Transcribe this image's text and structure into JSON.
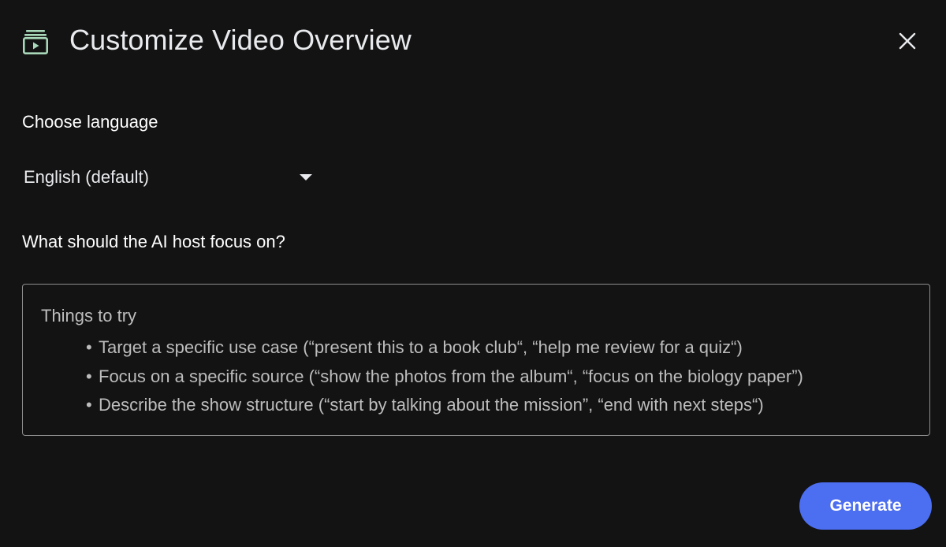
{
  "dialog": {
    "title": "Customize Video Overview",
    "header_icon": "video-overview-icon",
    "close_icon": "close-icon"
  },
  "language": {
    "label": "Choose language",
    "selected": "English (default)"
  },
  "focus": {
    "label": "What should the AI host focus on?",
    "placeholder_heading": "Things to try",
    "placeholder_items": [
      "Target a specific use case (“present this to a book club“, “help me review for a quiz“)",
      "Focus on a specific source (“show the photos from the album“, “focus on the biology paper”)",
      "Describe the show structure (“start by talking about the mission”, “end with next steps“)"
    ]
  },
  "actions": {
    "generate_label": "Generate"
  },
  "colors": {
    "background": "#131313",
    "accent": "#4c6ef0",
    "icon_green": "#a8d8b9",
    "text": "#e8eaed",
    "placeholder": "#bdbdbd"
  }
}
